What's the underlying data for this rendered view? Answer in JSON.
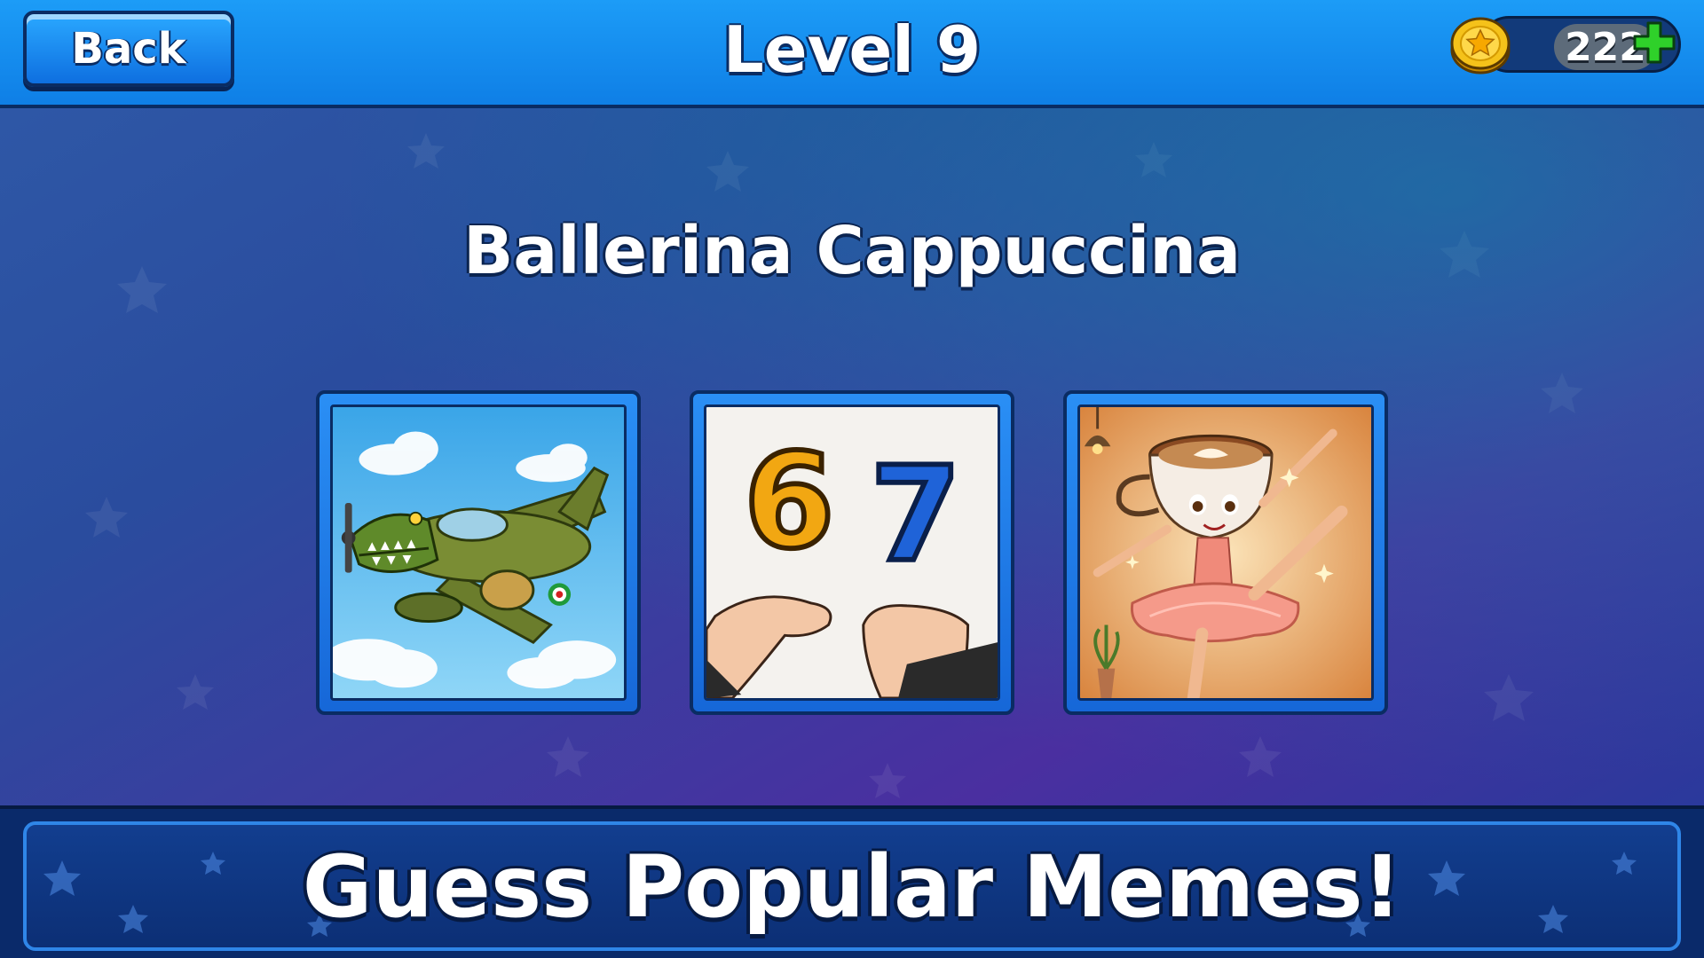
{
  "header": {
    "back_label": "Back",
    "level_title": "Level 9",
    "coins": "222"
  },
  "question": {
    "text": "Ballerina Cappuccina"
  },
  "choices": [
    {
      "image": "crocodile-bomber-plane"
    },
    {
      "image": "six-seven-hands",
      "digits": [
        "6",
        "7"
      ]
    },
    {
      "image": "ballerina-cappuccina"
    }
  ],
  "banner": {
    "text": "Guess Popular Memes!"
  },
  "colors": {
    "topbar": "#1c9cf7",
    "outline": "#0a2c63",
    "coin": "#f5c21a",
    "plus": "#2fd12a"
  },
  "icons": [
    "star-coin-icon",
    "plus-icon"
  ]
}
